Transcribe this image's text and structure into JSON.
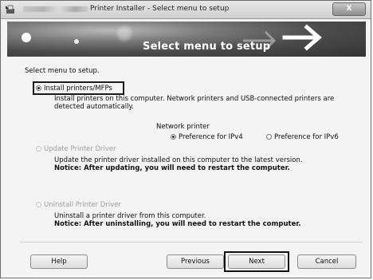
{
  "window": {
    "title": "Printer Installer - Select menu to setup",
    "close_label": "X"
  },
  "banner": {
    "title": "Select menu to setup"
  },
  "content": {
    "prompt": "Select menu to setup.",
    "options": [
      {
        "label": "Install printers/MFPs",
        "selected": true,
        "enabled": true,
        "description": "Install printers on this computer. Network printers and USB-connected printers are detected automatically.",
        "notice": ""
      },
      {
        "label": "Update Printer Driver",
        "selected": false,
        "enabled": false,
        "description": "Update the printer driver installed on this computer to the latest version.",
        "notice": "Notice: After updating, you will need to restart the computer."
      },
      {
        "label": "Uninstall Printer Driver",
        "selected": false,
        "enabled": false,
        "description": "Uninstall a printer driver from this computer.",
        "notice": "Notice: After uninstalling, you will need to restart the computer."
      }
    ],
    "network_printer": {
      "label": "Network printer",
      "options": [
        {
          "label": "Preference for IPv4",
          "selected": true
        },
        {
          "label": "Preference for IPv6",
          "selected": false
        }
      ]
    }
  },
  "buttons": {
    "help": "Help",
    "previous": "Previous",
    "next": "Next",
    "cancel": "Cancel"
  }
}
